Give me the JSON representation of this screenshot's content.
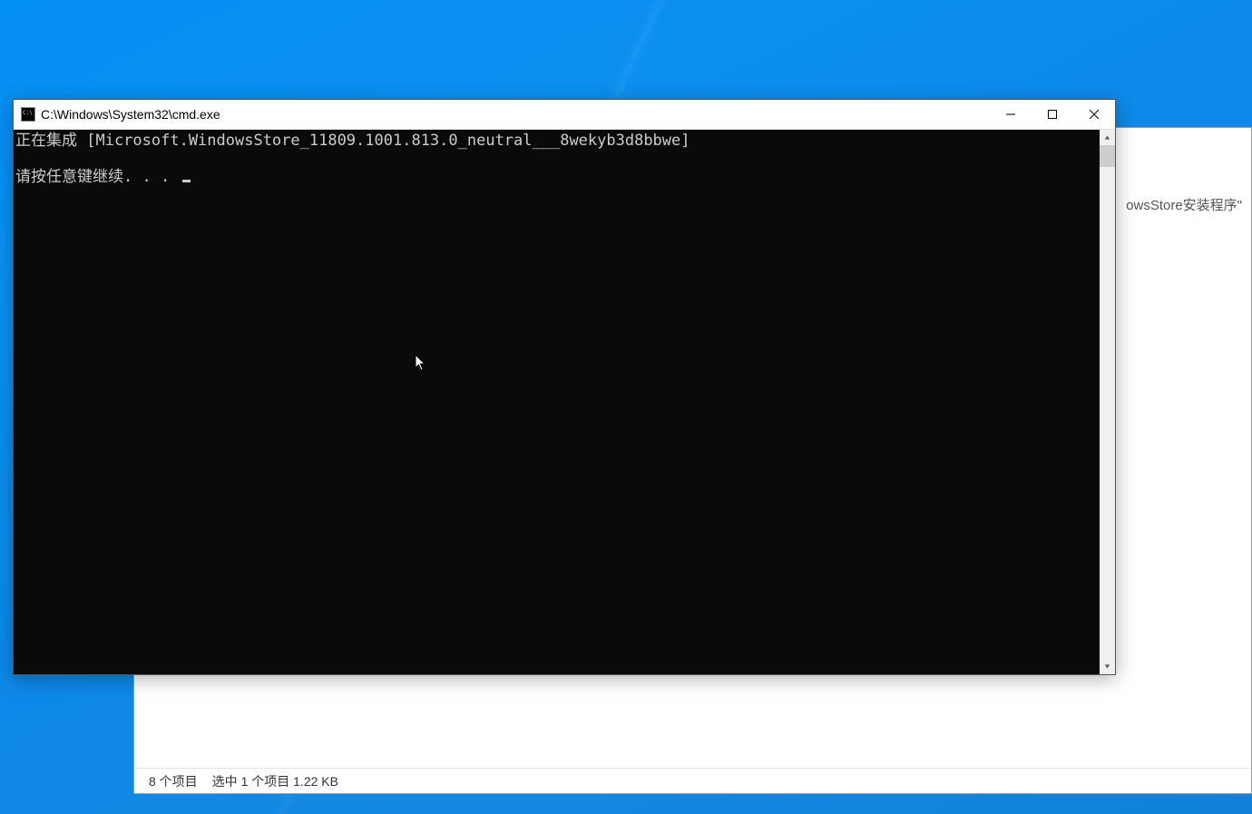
{
  "desktop": {
    "background_style": "windows-10-blue"
  },
  "explorer": {
    "address_fragment": "owsStore安装程序\"",
    "statusbar": {
      "item_count": "8 个项目",
      "selection": "选中 1 个项目  1.22 KB"
    }
  },
  "cmd": {
    "title": "C:\\Windows\\System32\\cmd.exe",
    "icon_name": "cmd-icon",
    "lines": {
      "line1": "正在集成 [Microsoft.WindowsStore_11809.1001.813.0_neutral___8wekyb3d8bbwe]",
      "line2": "请按任意键继续. . . "
    }
  }
}
